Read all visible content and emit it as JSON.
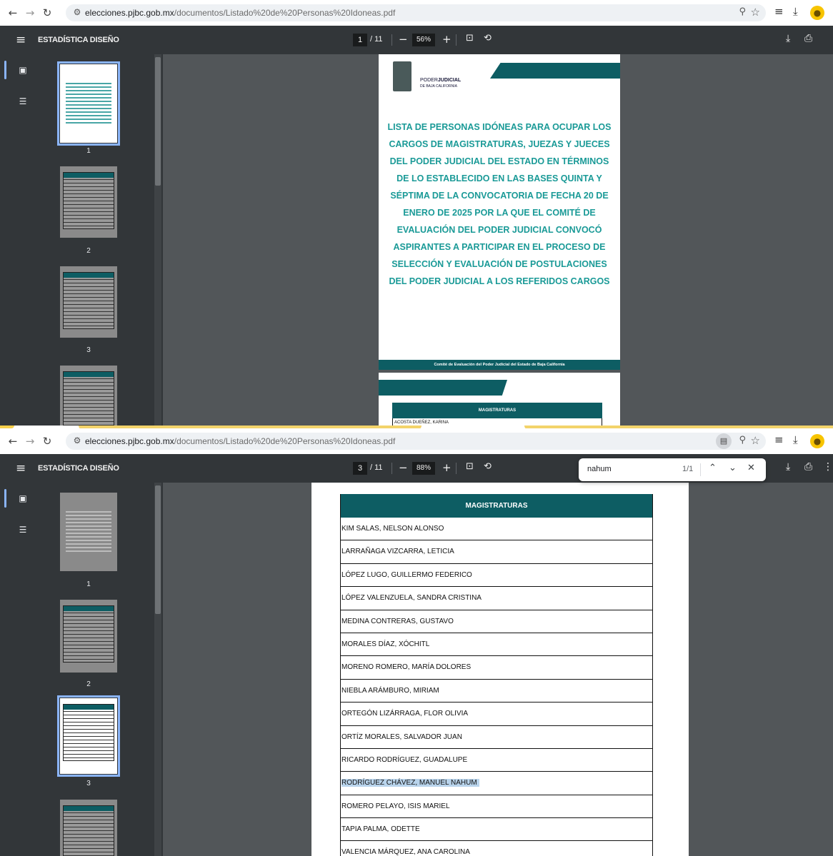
{
  "browser": {
    "url_host": "elecciones.pjbc.gob.mx",
    "url_path": "/documentos/Listado%20de%20Personas%20Idoneas.pdf",
    "icons": [
      "back-icon",
      "forward-icon",
      "reload-icon",
      "site-settings-icon",
      "zoom-icon",
      "star-icon",
      "reading-list-icon",
      "download-icon",
      "profile-icon"
    ]
  },
  "top_view": {
    "toolbar": {
      "title": "ESTADÍSTICA DISEÑO",
      "page_current": "1",
      "page_total": "/ 11",
      "zoom": "56%",
      "zoom_out": "−",
      "zoom_in": "+"
    },
    "thumbnails": [
      "1",
      "2",
      "3"
    ],
    "page1": {
      "logo_line1a": "PODER",
      "logo_line1b": "JUDICIAL",
      "logo_line2": "DE BAJA CALIFORNIA",
      "heading": "LISTA DE PERSONAS IDÓNEAS PARA OCUPAR LOS CARGOS DE MAGISTRATURAS, JUEZAS Y JUECES DEL PODER JUDICIAL DEL ESTADO EN TÉRMINOS DE LO ESTABLECIDO EN LAS BASES QUINTA Y SÉPTIMA DE LA CONVOCATORIA DE FECHA 20 DE ENERO DE 2025 POR LA QUE EL COMITÉ DE EVALUACIÓN DEL PODER JUDICIAL CONVOCÓ ASPIRANTES A PARTICIPAR EN EL PROCESO DE SELECCIÓN Y EVALUACIÓN DE POSTULACIONES DEL PODER JUDICIAL A LOS REFERIDOS CARGOS",
      "footer": "Comité de Evaluación del Poder Judicial del Estado de Baja California"
    },
    "page2": {
      "table_header": "MAGISTRATURAS",
      "first_row": "ACOSTA DUEÑEZ, KARINA"
    }
  },
  "bottom_view": {
    "toolbar": {
      "title": "ESTADÍSTICA DISEÑO",
      "page_current": "3",
      "page_total": "/ 11",
      "zoom": "88%",
      "zoom_out": "−",
      "zoom_in": "+"
    },
    "find": {
      "query": "nahum",
      "count": "1/1"
    },
    "thumbnails": [
      "1",
      "2",
      "3"
    ],
    "table_header": "MAGISTRATURAS",
    "rows": [
      "KIM SALAS, NELSON ALONSO",
      "LARRAÑAGA VIZCARRA, LETICIA",
      "LÓPEZ LUGO, GUILLERMO FEDERICO",
      "LÓPEZ VALENZUELA, SANDRA CRISTINA",
      "MEDINA CONTRERAS, GUSTAVO",
      "MORALES DÍAZ, XÓCHITL",
      "MORENO ROMERO, MARÍA DOLORES",
      "NIEBLA ARÁMBURO, MIRIAM",
      "ORTEGÓN LIZÁRRAGA, FLOR OLIVIA",
      "ORTÍZ MORALES, SALVADOR JUAN",
      "RICARDO RODRÍGUEZ, GUADALUPE",
      "RODRÍGUEZ CHÁVEZ, MANUEL NAHUM",
      "ROMERO PELAYO, ISIS MARIEL",
      "TAPIA PALMA, ODETTE",
      "VALENCIA MÁRQUEZ, ANA CAROLINA"
    ],
    "highlighted_row_index": 11
  },
  "colors": {
    "toolbar": "#323639",
    "viewer_bg": "#525659",
    "accent_teal": "#0d5d63",
    "heading_teal": "#1a9a97",
    "find_highlight": "#b9d4ec"
  }
}
